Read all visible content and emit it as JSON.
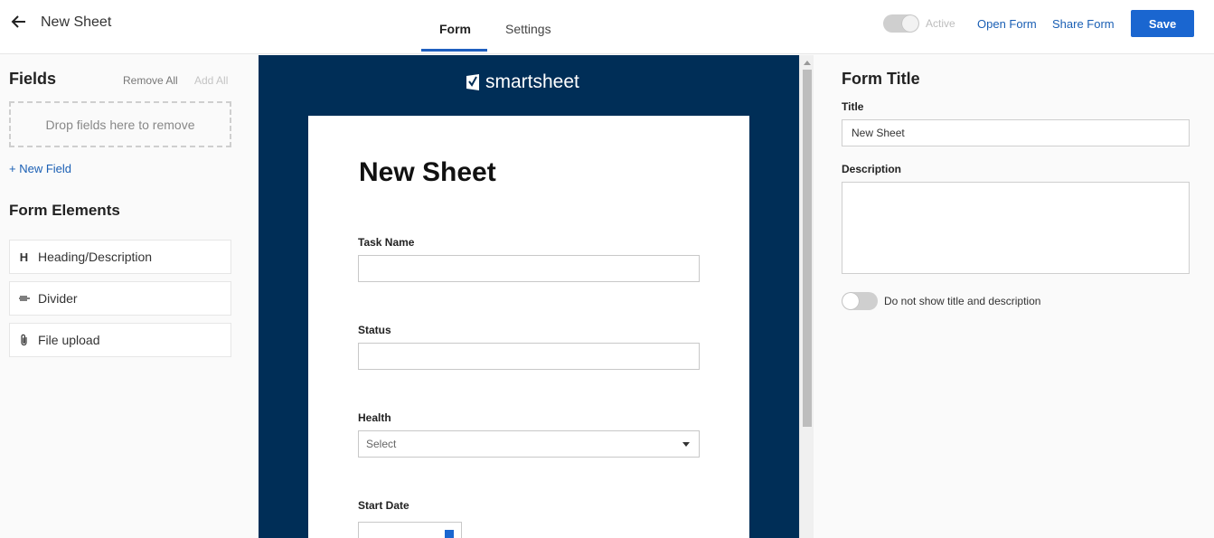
{
  "header": {
    "title": "New Sheet",
    "tabs": [
      {
        "label": "Form"
      },
      {
        "label": "Settings"
      }
    ],
    "active_label": "Active",
    "open_form": "Open Form",
    "share_form": "Share Form",
    "save": "Save",
    "accent_color": "#1a66d0"
  },
  "left": {
    "fields_title": "Fields",
    "remove_all": "Remove All",
    "add_all": "Add All",
    "drop_zone": "Drop fields here to remove",
    "new_field": "+ New Field",
    "elements_title": "Form Elements",
    "elements": [
      {
        "icon": "H",
        "label": "Heading/Description"
      },
      {
        "icon": "divider-icon",
        "label": "Divider"
      },
      {
        "icon": "paperclip-icon",
        "label": "File upload"
      }
    ]
  },
  "preview": {
    "brand": "smartsheet",
    "title": "New Sheet",
    "fields": [
      {
        "label": "Task Name"
      },
      {
        "label": "Status"
      },
      {
        "label": "Health",
        "placeholder": "Select"
      },
      {
        "label": "Start Date"
      }
    ],
    "background_color": "#002e57"
  },
  "right": {
    "form_title_heading": "Form Title",
    "title_label": "Title",
    "title_value": "New Sheet",
    "description_label": "Description",
    "hide_label": "Do not show title and description"
  }
}
